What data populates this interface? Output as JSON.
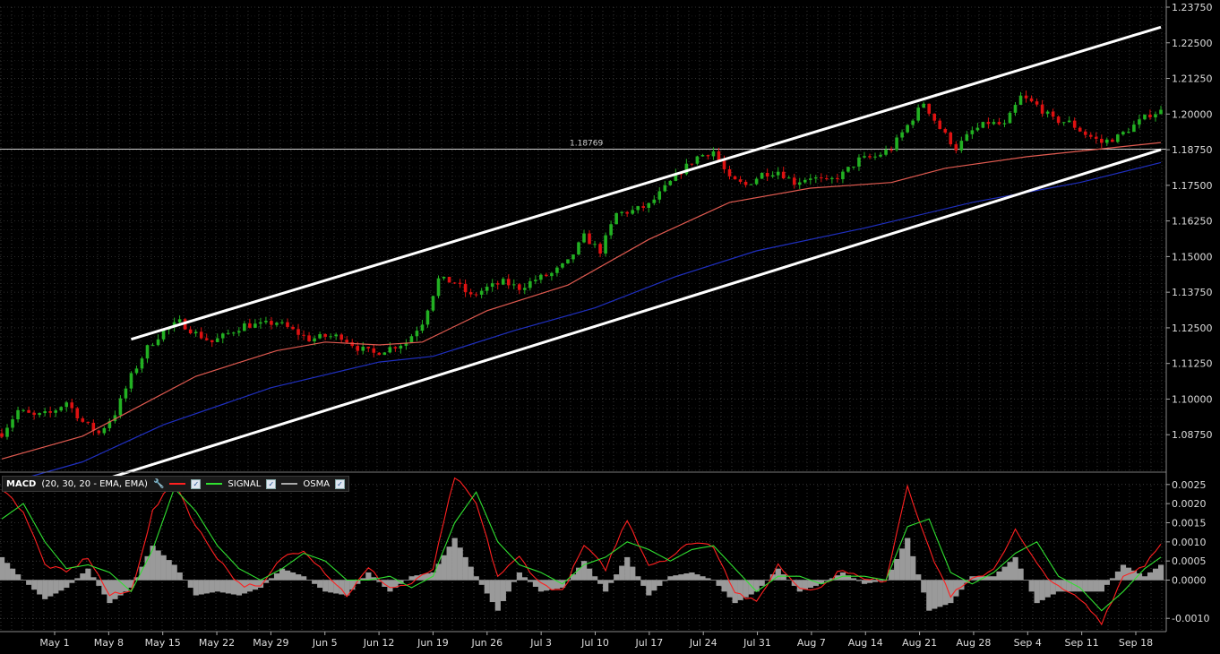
{
  "chart_data": [
    {
      "type": "candlestick",
      "title": "",
      "price_axis": {
        "ylim": [
          1.075,
          1.2375
        ],
        "ticks": [
          "1.23750",
          "1.22500",
          "1.21250",
          "1.20000",
          "1.18750",
          "1.17500",
          "1.16250",
          "1.15000",
          "1.13750",
          "1.12500",
          "1.11250",
          "1.10000",
          "1.08750"
        ]
      },
      "current_price_line": {
        "value": 1.18769,
        "label": "1.18769"
      },
      "date_axis": {
        "labels": [
          "May 1",
          "May 8",
          "May 15",
          "May 22",
          "May 29",
          "Jun 5",
          "Jun 12",
          "Jun 19",
          "Jun 26",
          "Jul 3",
          "Jul 10",
          "Jul 17",
          "Jul 24",
          "Jul 31",
          "Aug 7",
          "Aug 14",
          "Aug 21",
          "Aug 28",
          "Sep 4",
          "Sep 11",
          "Sep 18"
        ]
      },
      "colors": {
        "up": "#22b022",
        "down": "#dd1111",
        "ma_fast": "#e05a50",
        "ma_slow": "#1f2fbf",
        "trendline": "#ffffff",
        "grid": "#5a5a5a"
      },
      "price_path": [
        [
          0,
          1.088
        ],
        [
          3,
          1.096
        ],
        [
          6,
          1.094
        ],
        [
          9,
          1.095
        ],
        [
          12,
          1.099
        ],
        [
          15,
          1.092
        ],
        [
          18,
          1.088
        ],
        [
          21,
          1.095
        ],
        [
          24,
          1.108
        ],
        [
          27,
          1.118
        ],
        [
          30,
          1.124
        ],
        [
          33,
          1.127
        ],
        [
          36,
          1.123
        ],
        [
          39,
          1.12
        ],
        [
          42,
          1.123
        ],
        [
          45,
          1.126
        ],
        [
          48,
          1.126
        ],
        [
          51,
          1.127
        ],
        [
          54,
          1.124
        ],
        [
          57,
          1.121
        ],
        [
          60,
          1.122
        ],
        [
          63,
          1.122
        ],
        [
          66,
          1.118
        ],
        [
          69,
          1.116
        ],
        [
          72,
          1.118
        ],
        [
          75,
          1.12
        ],
        [
          78,
          1.127
        ],
        [
          81,
          1.142
        ],
        [
          84,
          1.141
        ],
        [
          87,
          1.136
        ],
        [
          90,
          1.139
        ],
        [
          93,
          1.141
        ],
        [
          96,
          1.139
        ],
        [
          99,
          1.142
        ],
        [
          102,
          1.144
        ],
        [
          105,
          1.148
        ],
        [
          108,
          1.157
        ],
        [
          111,
          1.152
        ],
        [
          114,
          1.165
        ],
        [
          117,
          1.166
        ],
        [
          120,
          1.168
        ],
        [
          123,
          1.174
        ],
        [
          126,
          1.18
        ],
        [
          129,
          1.185
        ],
        [
          132,
          1.187
        ],
        [
          135,
          1.177
        ],
        [
          138,
          1.175
        ],
        [
          141,
          1.179
        ],
        [
          144,
          1.18
        ],
        [
          147,
          1.176
        ],
        [
          150,
          1.178
        ],
        [
          153,
          1.176
        ],
        [
          156,
          1.179
        ],
        [
          159,
          1.184
        ],
        [
          162,
          1.185
        ],
        [
          165,
          1.188
        ],
        [
          168,
          1.196
        ],
        [
          171,
          1.204
        ],
        [
          174,
          1.195
        ],
        [
          177,
          1.188
        ],
        [
          180,
          1.194
        ],
        [
          183,
          1.197
        ],
        [
          186,
          1.196
        ],
        [
          189,
          1.206
        ],
        [
          192,
          1.203
        ],
        [
          195,
          1.198
        ],
        [
          198,
          1.197
        ],
        [
          201,
          1.193
        ],
        [
          204,
          1.19
        ],
        [
          207,
          1.192
        ],
        [
          210,
          1.196
        ],
        [
          213,
          1.2
        ],
        [
          215,
          1.201
        ]
      ],
      "moving_averages": [
        {
          "name": "",
          "points": [
            [
              0,
              1.079
            ],
            [
              15,
              1.087
            ],
            [
              24,
              1.096
            ],
            [
              36,
              1.108
            ],
            [
              51,
              1.117
            ],
            [
              60,
              1.12
            ],
            [
              70,
              1.119
            ],
            [
              78,
              1.12
            ],
            [
              90,
              1.131
            ],
            [
              105,
              1.14
            ],
            [
              120,
              1.156
            ],
            [
              135,
              1.169
            ],
            [
              150,
              1.174
            ],
            [
              165,
              1.176
            ],
            [
              175,
              1.181
            ],
            [
              190,
              1.185
            ],
            [
              205,
              1.188
            ],
            [
              215,
              1.19
            ]
          ]
        },
        {
          "name": "",
          "points": [
            [
              0,
              1.07
            ],
            [
              15,
              1.078
            ],
            [
              30,
              1.091
            ],
            [
              50,
              1.104
            ],
            [
              70,
              1.113
            ],
            [
              80,
              1.115
            ],
            [
              95,
              1.124
            ],
            [
              110,
              1.132
            ],
            [
              125,
              1.143
            ],
            [
              140,
              1.152
            ],
            [
              160,
              1.16
            ],
            [
              180,
              1.169
            ],
            [
              200,
              1.176
            ],
            [
              215,
              1.183
            ]
          ]
        }
      ],
      "trendlines": [
        {
          "from": [
            24,
            1.121
          ],
          "to": [
            215,
            1.2305
          ]
        },
        {
          "from": [
            16,
            1.07
          ],
          "to": [
            215,
            1.1875
          ]
        }
      ]
    },
    {
      "type": "line",
      "indicator": "MACD",
      "params": "(20, 30, 20 - EMA, EMA)",
      "ylim": [
        -0.0013,
        0.0028
      ],
      "ticks": [
        "0.0025",
        "0.0020",
        "0.0015",
        "0.0010",
        "0.0005",
        "0.0000",
        "-0.0010"
      ],
      "tick_values": [
        0.0025,
        0.002,
        0.0015,
        0.001,
        0.0005,
        0.0,
        -0.001
      ],
      "series": [
        {
          "name": "",
          "color": "#ff2020",
          "points": [
            [
              0,
              0.0024
            ],
            [
              4,
              0.0018
            ],
            [
              8,
              0.0004
            ],
            [
              12,
              0.0002
            ],
            [
              16,
              0.0006
            ],
            [
              20,
              -0.0004
            ],
            [
              24,
              -0.0003
            ],
            [
              28,
              0.0018
            ],
            [
              32,
              0.0026
            ],
            [
              36,
              0.0014
            ],
            [
              40,
              0.0006
            ],
            [
              44,
              -0.0001
            ],
            [
              48,
              -0.0002
            ],
            [
              52,
              0.0006
            ],
            [
              56,
              0.0008
            ],
            [
              60,
              0.0002
            ],
            [
              64,
              -0.0004
            ],
            [
              68,
              0.0003
            ],
            [
              72,
              -0.0002
            ],
            [
              76,
              -0.0001
            ],
            [
              80,
              0.0003
            ],
            [
              84,
              0.0027
            ],
            [
              88,
              0.002
            ],
            [
              92,
              0.0001
            ],
            [
              96,
              0.0006
            ],
            [
              100,
              -0.0001
            ],
            [
              104,
              -0.0003
            ],
            [
              108,
              0.0009
            ],
            [
              112,
              0.0003
            ],
            [
              116,
              0.0016
            ],
            [
              120,
              0.0004
            ],
            [
              124,
              0.0006
            ],
            [
              128,
              0.001
            ],
            [
              132,
              0.0009
            ],
            [
              136,
              -0.0003
            ],
            [
              140,
              -0.0006
            ],
            [
              144,
              0.0004
            ],
            [
              148,
              -0.0002
            ],
            [
              152,
              -0.0002
            ],
            [
              156,
              0.0003
            ],
            [
              160,
              0.0
            ],
            [
              164,
              0.0
            ],
            [
              168,
              0.0025
            ],
            [
              172,
              0.0008
            ],
            [
              176,
              -0.0004
            ],
            [
              180,
              0.0
            ],
            [
              184,
              0.0003
            ],
            [
              188,
              0.0013
            ],
            [
              192,
              0.0004
            ],
            [
              196,
              -0.0002
            ],
            [
              200,
              -0.0005
            ],
            [
              204,
              -0.0011
            ],
            [
              208,
              0.0001
            ],
            [
              212,
              0.0004
            ],
            [
              215,
              0.001
            ]
          ]
        },
        {
          "name": "SIGNAL",
          "color": "#30e030",
          "points": [
            [
              0,
              0.0016
            ],
            [
              4,
              0.002
            ],
            [
              8,
              0.001
            ],
            [
              12,
              0.0003
            ],
            [
              16,
              0.0004
            ],
            [
              20,
              0.0002
            ],
            [
              24,
              -0.0003
            ],
            [
              28,
              0.0008
            ],
            [
              32,
              0.0024
            ],
            [
              36,
              0.0018
            ],
            [
              40,
              0.0009
            ],
            [
              44,
              0.0003
            ],
            [
              48,
              0.0
            ],
            [
              52,
              0.0003
            ],
            [
              56,
              0.0007
            ],
            [
              60,
              0.0005
            ],
            [
              64,
              0.0
            ],
            [
              68,
              0.0
            ],
            [
              72,
              0.0001
            ],
            [
              76,
              -0.0002
            ],
            [
              80,
              0.0001
            ],
            [
              84,
              0.0015
            ],
            [
              88,
              0.0023
            ],
            [
              92,
              0.001
            ],
            [
              96,
              0.0004
            ],
            [
              100,
              0.0002
            ],
            [
              104,
              -0.0001
            ],
            [
              108,
              0.0004
            ],
            [
              112,
              0.0006
            ],
            [
              116,
              0.001
            ],
            [
              120,
              0.0008
            ],
            [
              124,
              0.0005
            ],
            [
              128,
              0.0008
            ],
            [
              132,
              0.0009
            ],
            [
              136,
              0.0003
            ],
            [
              140,
              -0.0003
            ],
            [
              144,
              0.0001
            ],
            [
              148,
              0.0001
            ],
            [
              152,
              -0.0001
            ],
            [
              156,
              0.0001
            ],
            [
              160,
              0.0001
            ],
            [
              164,
              0.0
            ],
            [
              168,
              0.0014
            ],
            [
              172,
              0.0016
            ],
            [
              176,
              0.0002
            ],
            [
              180,
              -0.0001
            ],
            [
              184,
              0.0002
            ],
            [
              188,
              0.0007
            ],
            [
              192,
              0.001
            ],
            [
              196,
              0.0001
            ],
            [
              200,
              -0.0002
            ],
            [
              204,
              -0.0008
            ],
            [
              208,
              -0.0003
            ],
            [
              212,
              0.0003
            ],
            [
              215,
              0.0006
            ]
          ]
        }
      ],
      "osma": {
        "name": "OSMA",
        "color": "#9a9a9a",
        "points": [
          [
            0,
            0.0006
          ],
          [
            4,
            0.0
          ],
          [
            8,
            -0.0005
          ],
          [
            12,
            -0.0002
          ],
          [
            16,
            0.0003
          ],
          [
            20,
            -0.0006
          ],
          [
            24,
            -0.0002
          ],
          [
            28,
            0.0009
          ],
          [
            32,
            0.0004
          ],
          [
            36,
            -0.0004
          ],
          [
            40,
            -0.0003
          ],
          [
            44,
            -0.0004
          ],
          [
            48,
            -0.0002
          ],
          [
            52,
            0.0003
          ],
          [
            56,
            0.0001
          ],
          [
            60,
            -0.0003
          ],
          [
            64,
            -0.0004
          ],
          [
            68,
            0.0002
          ],
          [
            72,
            -0.0003
          ],
          [
            76,
            0.0001
          ],
          [
            80,
            0.0002
          ],
          [
            84,
            0.0011
          ],
          [
            88,
            0.0001
          ],
          [
            92,
            -0.0008
          ],
          [
            96,
            0.0002
          ],
          [
            100,
            -0.0003
          ],
          [
            104,
            -0.0002
          ],
          [
            108,
            0.0005
          ],
          [
            112,
            -0.0003
          ],
          [
            116,
            0.0006
          ],
          [
            120,
            -0.0004
          ],
          [
            124,
            0.0001
          ],
          [
            128,
            0.0002
          ],
          [
            132,
            0.0
          ],
          [
            136,
            -0.0006
          ],
          [
            140,
            -0.0003
          ],
          [
            144,
            0.0003
          ],
          [
            148,
            -0.0003
          ],
          [
            152,
            -0.0001
          ],
          [
            156,
            0.0002
          ],
          [
            160,
            -0.0001
          ],
          [
            164,
            0.0
          ],
          [
            168,
            0.0011
          ],
          [
            172,
            -0.0008
          ],
          [
            176,
            -0.0006
          ],
          [
            180,
            0.0001
          ],
          [
            184,
            0.0001
          ],
          [
            188,
            0.0006
          ],
          [
            192,
            -0.0006
          ],
          [
            196,
            -0.0003
          ],
          [
            200,
            -0.0003
          ],
          [
            204,
            -0.0003
          ],
          [
            208,
            0.0004
          ],
          [
            212,
            0.0001
          ],
          [
            215,
            0.0004
          ]
        ]
      }
    }
  ],
  "legend": {
    "name": "MACD",
    "params": "(20, 30, 20 - EMA, EMA)",
    "signal": "SIGNAL",
    "osma": "OSMA",
    "check": "✓",
    "gear": "🔧"
  }
}
